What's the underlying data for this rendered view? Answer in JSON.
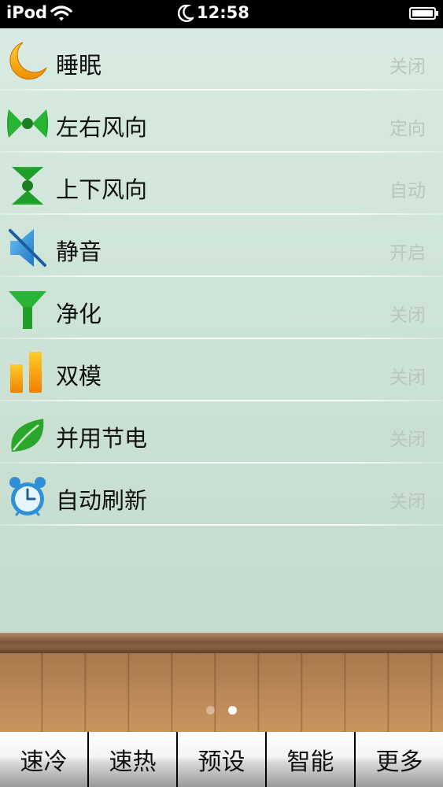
{
  "status_bar": {
    "carrier": "iPod",
    "time": "12:58"
  },
  "settings": [
    {
      "label": "睡眠",
      "value": "关闭",
      "icon": "moon-icon"
    },
    {
      "label": "左右风向",
      "value": "定向",
      "icon": "horizontal-swing-icon"
    },
    {
      "label": "上下风向",
      "value": "自动",
      "icon": "vertical-swing-icon"
    },
    {
      "label": "静音",
      "value": "开启",
      "icon": "mute-speaker-icon"
    },
    {
      "label": "净化",
      "value": "关闭",
      "icon": "funnel-filter-icon"
    },
    {
      "label": "双模",
      "value": "关闭",
      "icon": "bars-icon"
    },
    {
      "label": "并用节电",
      "value": "关闭",
      "icon": "leaf-icon"
    },
    {
      "label": "自动刷新",
      "value": "关闭",
      "icon": "alarm-clock-icon"
    }
  ],
  "pager": {
    "total": 2,
    "current": 2
  },
  "tabs": [
    {
      "label": "速冷"
    },
    {
      "label": "速热"
    },
    {
      "label": "预设"
    },
    {
      "label": "智能"
    },
    {
      "label": "更多"
    }
  ],
  "colors": {
    "wall": "#cfe4d8",
    "floor": "#b98758",
    "value_text": "#b9c7bf",
    "icon_green": "#2aa62a",
    "icon_orange": "#f5a000",
    "icon_blue": "#2f8fd8"
  }
}
